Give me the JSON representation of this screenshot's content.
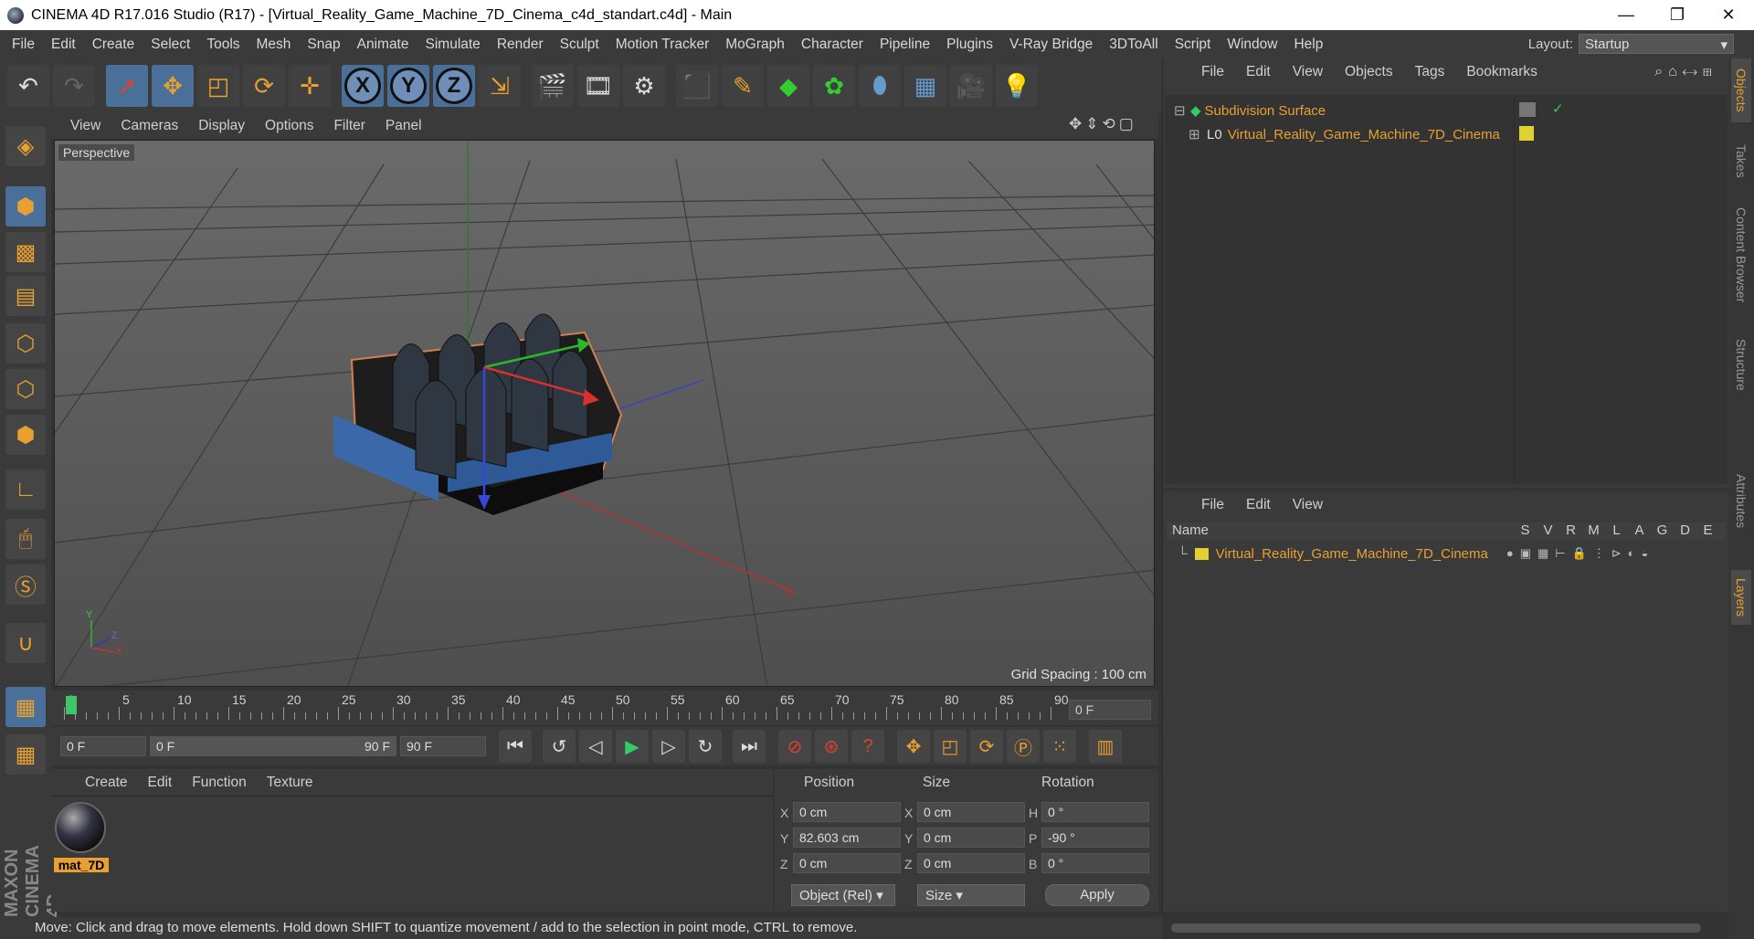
{
  "window": {
    "title": "CINEMA 4D R17.016 Studio (R17) - [Virtual_Reality_Game_Machine_7D_Cinema_c4d_standart.c4d] - Main"
  },
  "menubar": [
    "File",
    "Edit",
    "Create",
    "Select",
    "Tools",
    "Mesh",
    "Snap",
    "Animate",
    "Simulate",
    "Render",
    "Sculpt",
    "Motion Tracker",
    "MoGraph",
    "Character",
    "Pipeline",
    "Plugins",
    "V-Ray Bridge",
    "3DToAll",
    "Script",
    "Window",
    "Help"
  ],
  "layout": {
    "label": "Layout:",
    "value": "Startup"
  },
  "toolbar": {
    "axes": [
      "X",
      "Y",
      "Z"
    ]
  },
  "viewport": {
    "menu": [
      "View",
      "Cameras",
      "Display",
      "Options",
      "Filter",
      "Panel"
    ],
    "label": "Perspective",
    "grid_spacing": "Grid Spacing : 100 cm"
  },
  "timeline": {
    "ticks": [
      "0",
      "5",
      "10",
      "15",
      "20",
      "25",
      "30",
      "35",
      "40",
      "45",
      "50",
      "55",
      "60",
      "65",
      "70",
      "75",
      "80",
      "85",
      "90"
    ],
    "current": "0 F"
  },
  "transport": {
    "start": "0 F",
    "range_start": "0 F",
    "range_end": "90 F",
    "end": "90 F"
  },
  "material": {
    "menu": [
      "Create",
      "Edit",
      "Function",
      "Texture"
    ],
    "name": "mat_7D"
  },
  "coords": {
    "headers": [
      "Position",
      "Size",
      "Rotation"
    ],
    "pos": [
      {
        "l": "X",
        "v": "0 cm"
      },
      {
        "l": "Y",
        "v": "82.603 cm"
      },
      {
        "l": "Z",
        "v": "0 cm"
      }
    ],
    "size": [
      {
        "l": "X",
        "v": "0 cm"
      },
      {
        "l": "Y",
        "v": "0 cm"
      },
      {
        "l": "Z",
        "v": "0 cm"
      }
    ],
    "rot": [
      {
        "l": "H",
        "v": "0 °"
      },
      {
        "l": "P",
        "v": "-90 °"
      },
      {
        "l": "B",
        "v": "0 °"
      }
    ],
    "mode": "Object (Rel)",
    "size_mode": "Size",
    "apply": "Apply"
  },
  "objects": {
    "menu": [
      "File",
      "Edit",
      "View",
      "Objects",
      "Tags",
      "Bookmarks"
    ],
    "rows": [
      "Subdivision Surface",
      "Virtual_Reality_Game_Machine_7D_Cinema"
    ]
  },
  "layers": {
    "menu": [
      "File",
      "Edit",
      "View"
    ],
    "header": "Name",
    "cols": [
      "S",
      "V",
      "R",
      "M",
      "L",
      "A",
      "G",
      "D",
      "E"
    ],
    "row": "Virtual_Reality_Game_Machine_7D_Cinema"
  },
  "status": "Move: Click and drag to move elements. Hold down SHIFT to quantize movement / add to the selection in point mode, CTRL to remove.",
  "sidetabs": [
    "Objects",
    "Takes",
    "Content Browser",
    "Structure",
    "Attributes",
    "Layers"
  ],
  "colors": {
    "accent": "#e8a030",
    "bg": "#3a3a3a"
  }
}
